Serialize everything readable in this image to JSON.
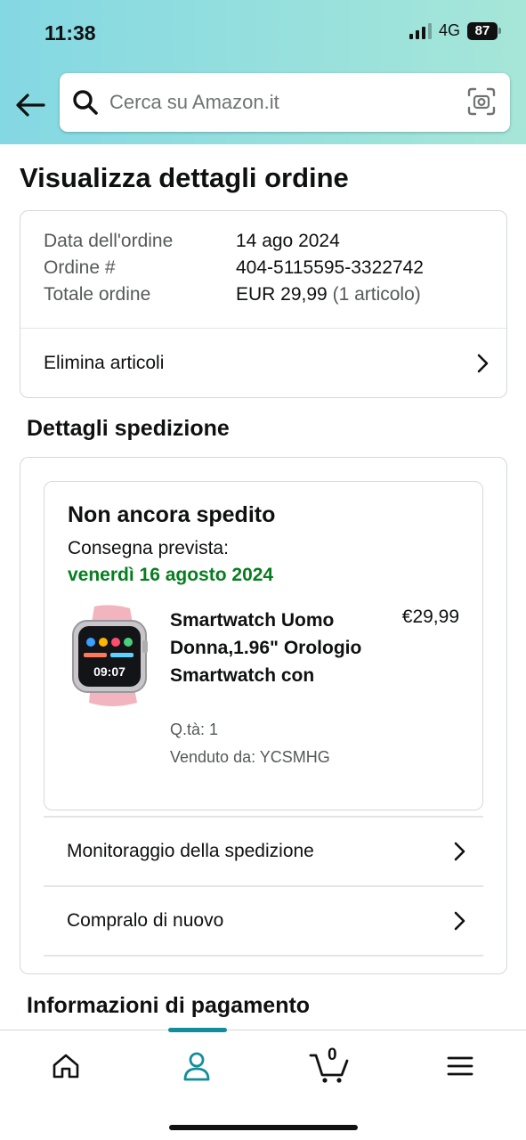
{
  "status_bar": {
    "time": "11:38",
    "network": "4G",
    "battery": "87"
  },
  "search": {
    "placeholder": "Cerca su Amazon.it",
    "value": ""
  },
  "page_title": "Visualizza dettagli ordine",
  "order_summary": {
    "date_label": "Data dell'ordine",
    "date_value": "14 ago 2024",
    "order_label": "Ordine #",
    "order_value": "404-5115595-3322742",
    "total_label": "Totale ordine",
    "total_value": "EUR 29,99",
    "total_items": "(1 articolo)",
    "remove_items_label": "Elimina articoli"
  },
  "shipment": {
    "section_title": "Dettagli spedizione",
    "status": "Non ancora spedito",
    "delivery_label": "Consegna prevista:",
    "delivery_date": "venerdì 16 agosto 2024",
    "product": {
      "title": "Smartwatch Uomo Donna,1.96\" Orologio Smartwatch con",
      "price": "€29,99",
      "quantity": "Q.tà: 1",
      "seller": "Venduto da: YCSMHG",
      "watch_face_time": "09:07"
    },
    "track_label": "Monitoraggio della spedizione",
    "buy_again_label": "Compralo di nuovo"
  },
  "payment": {
    "section_title": "Informazioni di pagamento"
  },
  "bottom_nav": {
    "cart_count": "0",
    "active": "account"
  },
  "colors": {
    "header_gradient_start": "#84d8e3",
    "header_gradient_end": "#a6e6d8",
    "delivery_green": "#067d1e",
    "nav_active": "#138d9a"
  }
}
